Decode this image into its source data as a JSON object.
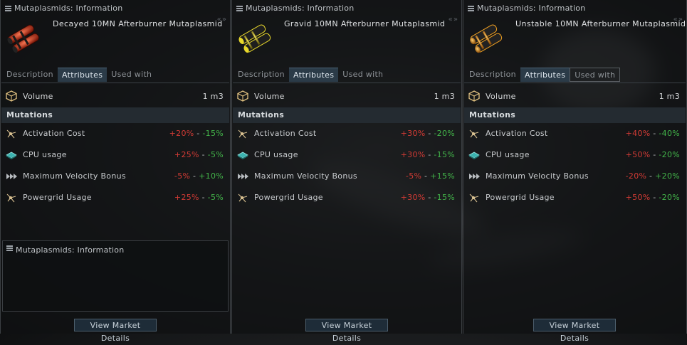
{
  "windows": [
    {
      "title": "Mutaplasmids: Information",
      "item_name": "Decayed 10MN Afterburner Mutaplasmid",
      "accent": "#d8452a",
      "tabs": [
        "Description",
        "Attributes",
        "Used with"
      ],
      "active_tab": "Attributes",
      "volume_label": "Volume",
      "volume_value": "1 m3",
      "mutations_header": "Mutations",
      "attributes": [
        {
          "icon": "activation-cost-icon",
          "label": "Activation Cost",
          "low": "+20%",
          "high": "-15%"
        },
        {
          "icon": "cpu-icon",
          "label": "CPU usage",
          "low": "+25%",
          "high": "-5%"
        },
        {
          "icon": "velocity-icon",
          "label": "Maximum Velocity Bonus",
          "low": "-5%",
          "high": "+10%"
        },
        {
          "icon": "powergrid-icon",
          "label": "Powergrid Usage",
          "low": "+25%",
          "high": "-5%"
        }
      ],
      "separator": "-",
      "market_button": "View Market Details",
      "sub_window_title": "Mutaplasmids: Information"
    },
    {
      "title": "Mutaplasmids: Information",
      "item_name": "Gravid 10MN Afterburner Mutaplasmid",
      "accent": "#e8d82a",
      "tabs": [
        "Description",
        "Attributes",
        "Used with"
      ],
      "active_tab": "Attributes",
      "volume_label": "Volume",
      "volume_value": "1 m3",
      "mutations_header": "Mutations",
      "attributes": [
        {
          "icon": "activation-cost-icon",
          "label": "Activation Cost",
          "low": "+30%",
          "high": "-20%"
        },
        {
          "icon": "cpu-icon",
          "label": "CPU usage",
          "low": "+30%",
          "high": "-15%"
        },
        {
          "icon": "velocity-icon",
          "label": "Maximum Velocity Bonus",
          "low": "-5%",
          "high": "+15%"
        },
        {
          "icon": "powergrid-icon",
          "label": "Powergrid Usage",
          "low": "+30%",
          "high": "-15%"
        }
      ],
      "separator": "-",
      "market_button": "View Market Details"
    },
    {
      "title": "Mutaplasmids: Information",
      "item_name": "Unstable 10MN Afterburner Mutaplasmid",
      "accent": "#f0a020",
      "tabs": [
        "Description",
        "Attributes",
        "Used with"
      ],
      "active_tab": "Attributes",
      "volume_label": "Volume",
      "volume_value": "1 m3",
      "mutations_header": "Mutations",
      "attributes": [
        {
          "icon": "activation-cost-icon",
          "label": "Activation Cost",
          "low": "+40%",
          "high": "-40%"
        },
        {
          "icon": "cpu-icon",
          "label": "CPU usage",
          "low": "+50%",
          "high": "-20%"
        },
        {
          "icon": "velocity-icon",
          "label": "Maximum Velocity Bonus",
          "low": "-20%",
          "high": "+20%"
        },
        {
          "icon": "powergrid-icon",
          "label": "Powergrid Usage",
          "low": "+50%",
          "high": "-20%"
        }
      ],
      "separator": "-",
      "market_button": "View Market Details"
    }
  ]
}
